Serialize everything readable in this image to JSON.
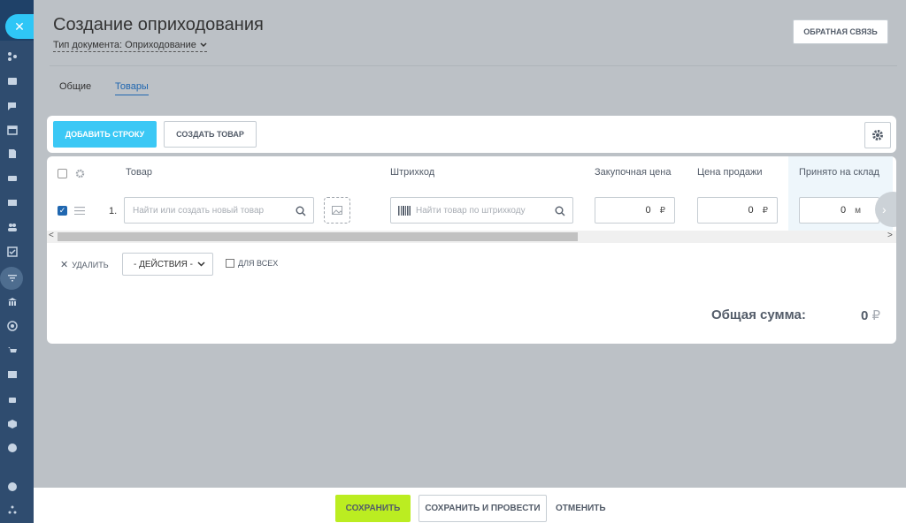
{
  "header": {
    "title": "Создание оприходования",
    "doc_type_label": "Тип документа: Оприходование",
    "feedback_label": "ОБРАТНАЯ СВЯЗЬ"
  },
  "tabs": [
    {
      "label": "Общие",
      "active": false
    },
    {
      "label": "Товары",
      "active": true
    }
  ],
  "toolbar": {
    "add_row_label": "ДОБАВИТЬ СТРОКУ",
    "create_product_label": "СОЗДАТЬ ТОВАР"
  },
  "table": {
    "columns": [
      "Товар",
      "Штрихкод",
      "Закупочная цена",
      "Цена продажи",
      "Принято на склад"
    ],
    "rows": [
      {
        "num": "1.",
        "checked": true,
        "product_placeholder": "Найти или создать новый товар",
        "barcode_placeholder": "Найти товар по штрихкоду",
        "purchase_price": "0",
        "sale_price": "0",
        "received": "0",
        "currency": "₽",
        "unit": "м"
      }
    ]
  },
  "bulk": {
    "delete_label": "УДАЛИТЬ",
    "actions_label": "- ДЕЙСТВИЯ -",
    "for_all_label": "ДЛЯ ВСЕХ"
  },
  "total": {
    "label": "Общая сумма:",
    "value": "0",
    "currency": "₽"
  },
  "footer": {
    "save_label": "СОХРАНИТЬ",
    "save_post_label": "СОХРАНИТЬ И ПРОВЕСТИ",
    "cancel_label": "ОТМЕНИТЬ"
  },
  "colors": {
    "accent_blue": "#3bc8f5",
    "save_green": "#bbed21",
    "sidebar": "#2f4c6f"
  },
  "sidebar_icons": [
    "sitemap-icon",
    "card-icon",
    "chat-icon",
    "calendar-icon",
    "document-icon",
    "drive-icon",
    "mail-icon",
    "users-icon",
    "tasks-icon",
    "funnel-icon",
    "bank-icon",
    "target-icon",
    "cart-icon",
    "contact-card-icon",
    "robot-icon",
    "box-icon",
    "check-circle-icon",
    "help-icon",
    "network-icon"
  ]
}
